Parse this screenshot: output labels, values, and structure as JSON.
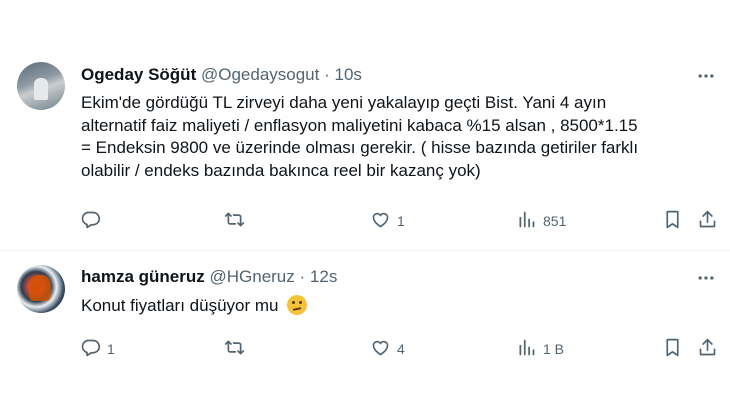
{
  "tweets": [
    {
      "name": "Ogeday Söğüt",
      "handle": "@Ogedaysogut",
      "sep": "·",
      "time": "10s",
      "text_lines": [
        "Ekim'de gördüğü TL zirveyi daha yeni yakalayıp geçti Bist. Yani 4 ayın",
        "alternatif faiz maliyeti / enflasyon maliyetini kabaca %15 alsan , 8500*1.15",
        "= Endeksin 9800 ve üzerinde olması gerekir. ( hisse bazında getiriler farklı",
        "olabilir / endeks bazında bakınca reel bir kazanç yok)"
      ],
      "replies": "",
      "retweets": "",
      "likes": "1",
      "views": "851"
    },
    {
      "name": "hamza güneruz",
      "handle": "@HGneruz",
      "sep": "·",
      "time": "12s",
      "text": "Konut fiyatları düşüyor mu",
      "emoji": "thinking-face-emoji",
      "replies": "1",
      "retweets": "",
      "likes": "4",
      "views": "1 B"
    }
  ],
  "icons": [
    "more-icon",
    "reply-icon",
    "retweet-icon",
    "like-icon",
    "views-icon",
    "bookmark-icon",
    "share-icon"
  ]
}
